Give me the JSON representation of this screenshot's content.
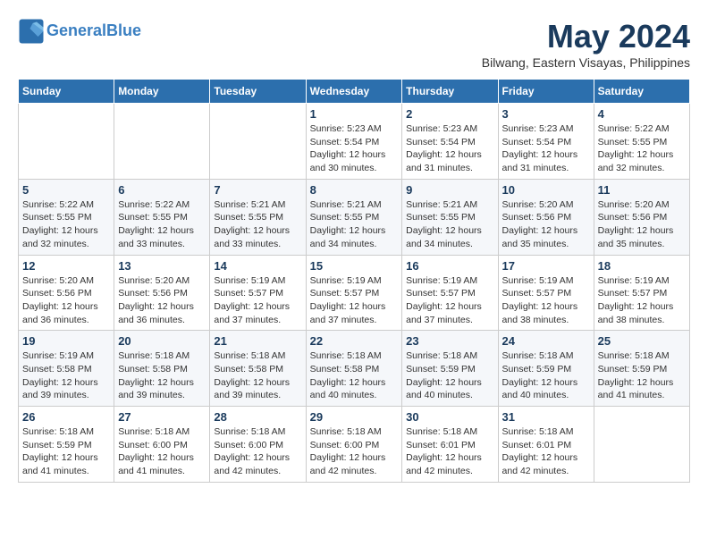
{
  "header": {
    "logo_line1": "General",
    "logo_line2": "Blue",
    "month": "May 2024",
    "location": "Bilwang, Eastern Visayas, Philippines"
  },
  "weekdays": [
    "Sunday",
    "Monday",
    "Tuesday",
    "Wednesday",
    "Thursday",
    "Friday",
    "Saturday"
  ],
  "weeks": [
    [
      {
        "day": "",
        "info": ""
      },
      {
        "day": "",
        "info": ""
      },
      {
        "day": "",
        "info": ""
      },
      {
        "day": "1",
        "info": "Sunrise: 5:23 AM\nSunset: 5:54 PM\nDaylight: 12 hours\nand 30 minutes."
      },
      {
        "day": "2",
        "info": "Sunrise: 5:23 AM\nSunset: 5:54 PM\nDaylight: 12 hours\nand 31 minutes."
      },
      {
        "day": "3",
        "info": "Sunrise: 5:23 AM\nSunset: 5:54 PM\nDaylight: 12 hours\nand 31 minutes."
      },
      {
        "day": "4",
        "info": "Sunrise: 5:22 AM\nSunset: 5:55 PM\nDaylight: 12 hours\nand 32 minutes."
      }
    ],
    [
      {
        "day": "5",
        "info": "Sunrise: 5:22 AM\nSunset: 5:55 PM\nDaylight: 12 hours\nand 32 minutes."
      },
      {
        "day": "6",
        "info": "Sunrise: 5:22 AM\nSunset: 5:55 PM\nDaylight: 12 hours\nand 33 minutes."
      },
      {
        "day": "7",
        "info": "Sunrise: 5:21 AM\nSunset: 5:55 PM\nDaylight: 12 hours\nand 33 minutes."
      },
      {
        "day": "8",
        "info": "Sunrise: 5:21 AM\nSunset: 5:55 PM\nDaylight: 12 hours\nand 34 minutes."
      },
      {
        "day": "9",
        "info": "Sunrise: 5:21 AM\nSunset: 5:55 PM\nDaylight: 12 hours\nand 34 minutes."
      },
      {
        "day": "10",
        "info": "Sunrise: 5:20 AM\nSunset: 5:56 PM\nDaylight: 12 hours\nand 35 minutes."
      },
      {
        "day": "11",
        "info": "Sunrise: 5:20 AM\nSunset: 5:56 PM\nDaylight: 12 hours\nand 35 minutes."
      }
    ],
    [
      {
        "day": "12",
        "info": "Sunrise: 5:20 AM\nSunset: 5:56 PM\nDaylight: 12 hours\nand 36 minutes."
      },
      {
        "day": "13",
        "info": "Sunrise: 5:20 AM\nSunset: 5:56 PM\nDaylight: 12 hours\nand 36 minutes."
      },
      {
        "day": "14",
        "info": "Sunrise: 5:19 AM\nSunset: 5:57 PM\nDaylight: 12 hours\nand 37 minutes."
      },
      {
        "day": "15",
        "info": "Sunrise: 5:19 AM\nSunset: 5:57 PM\nDaylight: 12 hours\nand 37 minutes."
      },
      {
        "day": "16",
        "info": "Sunrise: 5:19 AM\nSunset: 5:57 PM\nDaylight: 12 hours\nand 37 minutes."
      },
      {
        "day": "17",
        "info": "Sunrise: 5:19 AM\nSunset: 5:57 PM\nDaylight: 12 hours\nand 38 minutes."
      },
      {
        "day": "18",
        "info": "Sunrise: 5:19 AM\nSunset: 5:57 PM\nDaylight: 12 hours\nand 38 minutes."
      }
    ],
    [
      {
        "day": "19",
        "info": "Sunrise: 5:19 AM\nSunset: 5:58 PM\nDaylight: 12 hours\nand 39 minutes."
      },
      {
        "day": "20",
        "info": "Sunrise: 5:18 AM\nSunset: 5:58 PM\nDaylight: 12 hours\nand 39 minutes."
      },
      {
        "day": "21",
        "info": "Sunrise: 5:18 AM\nSunset: 5:58 PM\nDaylight: 12 hours\nand 39 minutes."
      },
      {
        "day": "22",
        "info": "Sunrise: 5:18 AM\nSunset: 5:58 PM\nDaylight: 12 hours\nand 40 minutes."
      },
      {
        "day": "23",
        "info": "Sunrise: 5:18 AM\nSunset: 5:59 PM\nDaylight: 12 hours\nand 40 minutes."
      },
      {
        "day": "24",
        "info": "Sunrise: 5:18 AM\nSunset: 5:59 PM\nDaylight: 12 hours\nand 40 minutes."
      },
      {
        "day": "25",
        "info": "Sunrise: 5:18 AM\nSunset: 5:59 PM\nDaylight: 12 hours\nand 41 minutes."
      }
    ],
    [
      {
        "day": "26",
        "info": "Sunrise: 5:18 AM\nSunset: 5:59 PM\nDaylight: 12 hours\nand 41 minutes."
      },
      {
        "day": "27",
        "info": "Sunrise: 5:18 AM\nSunset: 6:00 PM\nDaylight: 12 hours\nand 41 minutes."
      },
      {
        "day": "28",
        "info": "Sunrise: 5:18 AM\nSunset: 6:00 PM\nDaylight: 12 hours\nand 42 minutes."
      },
      {
        "day": "29",
        "info": "Sunrise: 5:18 AM\nSunset: 6:00 PM\nDaylight: 12 hours\nand 42 minutes."
      },
      {
        "day": "30",
        "info": "Sunrise: 5:18 AM\nSunset: 6:01 PM\nDaylight: 12 hours\nand 42 minutes."
      },
      {
        "day": "31",
        "info": "Sunrise: 5:18 AM\nSunset: 6:01 PM\nDaylight: 12 hours\nand 42 minutes."
      },
      {
        "day": "",
        "info": ""
      }
    ]
  ]
}
